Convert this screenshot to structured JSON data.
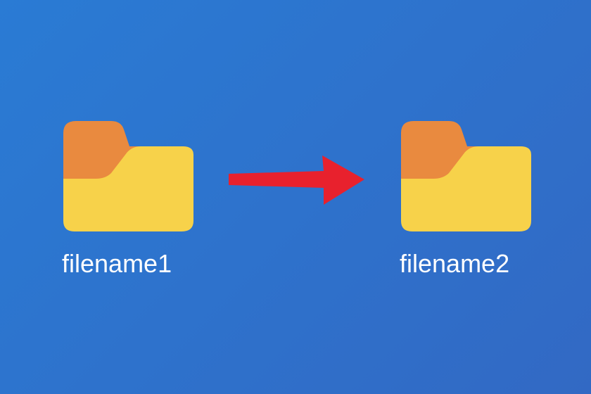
{
  "diagram": {
    "source": {
      "label": "filename1",
      "icon": "folder-icon"
    },
    "destination": {
      "label": "filename2",
      "icon": "folder-icon"
    },
    "arrow": {
      "icon": "arrow-right-icon",
      "color": "#e8212d"
    },
    "colors": {
      "folder_front": "#f7d24a",
      "folder_back": "#e98a3f",
      "arrow": "#e8212d",
      "background_start": "#2a7bd4",
      "background_end": "#3269c4",
      "text": "#ffffff"
    }
  }
}
